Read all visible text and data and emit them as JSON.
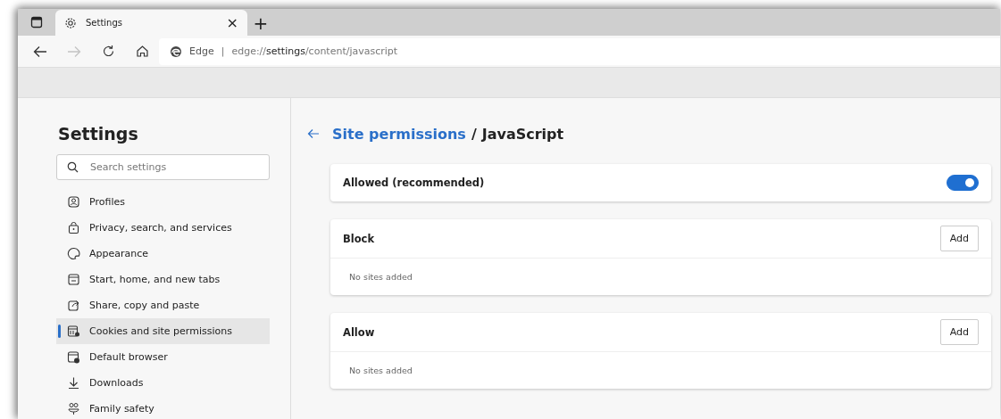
{
  "tab": {
    "title": "Settings",
    "close": "×",
    "new_tab": "+"
  },
  "toolbar": {
    "back_disabled": false,
    "forward_disabled": true,
    "site_label": "Edge",
    "separator": "|",
    "address": "edge://**settings**/content/javascript"
  },
  "sidebar": {
    "title": "Settings",
    "search": {
      "placeholder": "Search settings"
    },
    "items": [
      {
        "label": "Profiles",
        "selected": false
      },
      {
        "label": "Privacy, search, and services",
        "selected": false
      },
      {
        "label": "Appearance",
        "selected": false
      },
      {
        "label": "Start, home, and new tabs",
        "selected": false
      },
      {
        "label": "Share, copy and paste",
        "selected": false
      },
      {
        "label": "Cookies and site permissions",
        "selected": true
      },
      {
        "label": "Default browser",
        "selected": false
      },
      {
        "label": "Downloads",
        "selected": false
      },
      {
        "label": "Family safety",
        "selected": false
      }
    ]
  },
  "breadcrumb": {
    "parent": "Site permissions",
    "separator": "/",
    "current": "JavaScript"
  },
  "cards": [
    {
      "kind": "toggle",
      "label": "Allowed (recommended)",
      "on": true
    },
    {
      "kind": "list",
      "label": "Block",
      "button": "Add",
      "empty": "No sites added"
    },
    {
      "kind": "list",
      "label": "Allow",
      "button": "Add",
      "empty": "No sites added"
    }
  ]
}
